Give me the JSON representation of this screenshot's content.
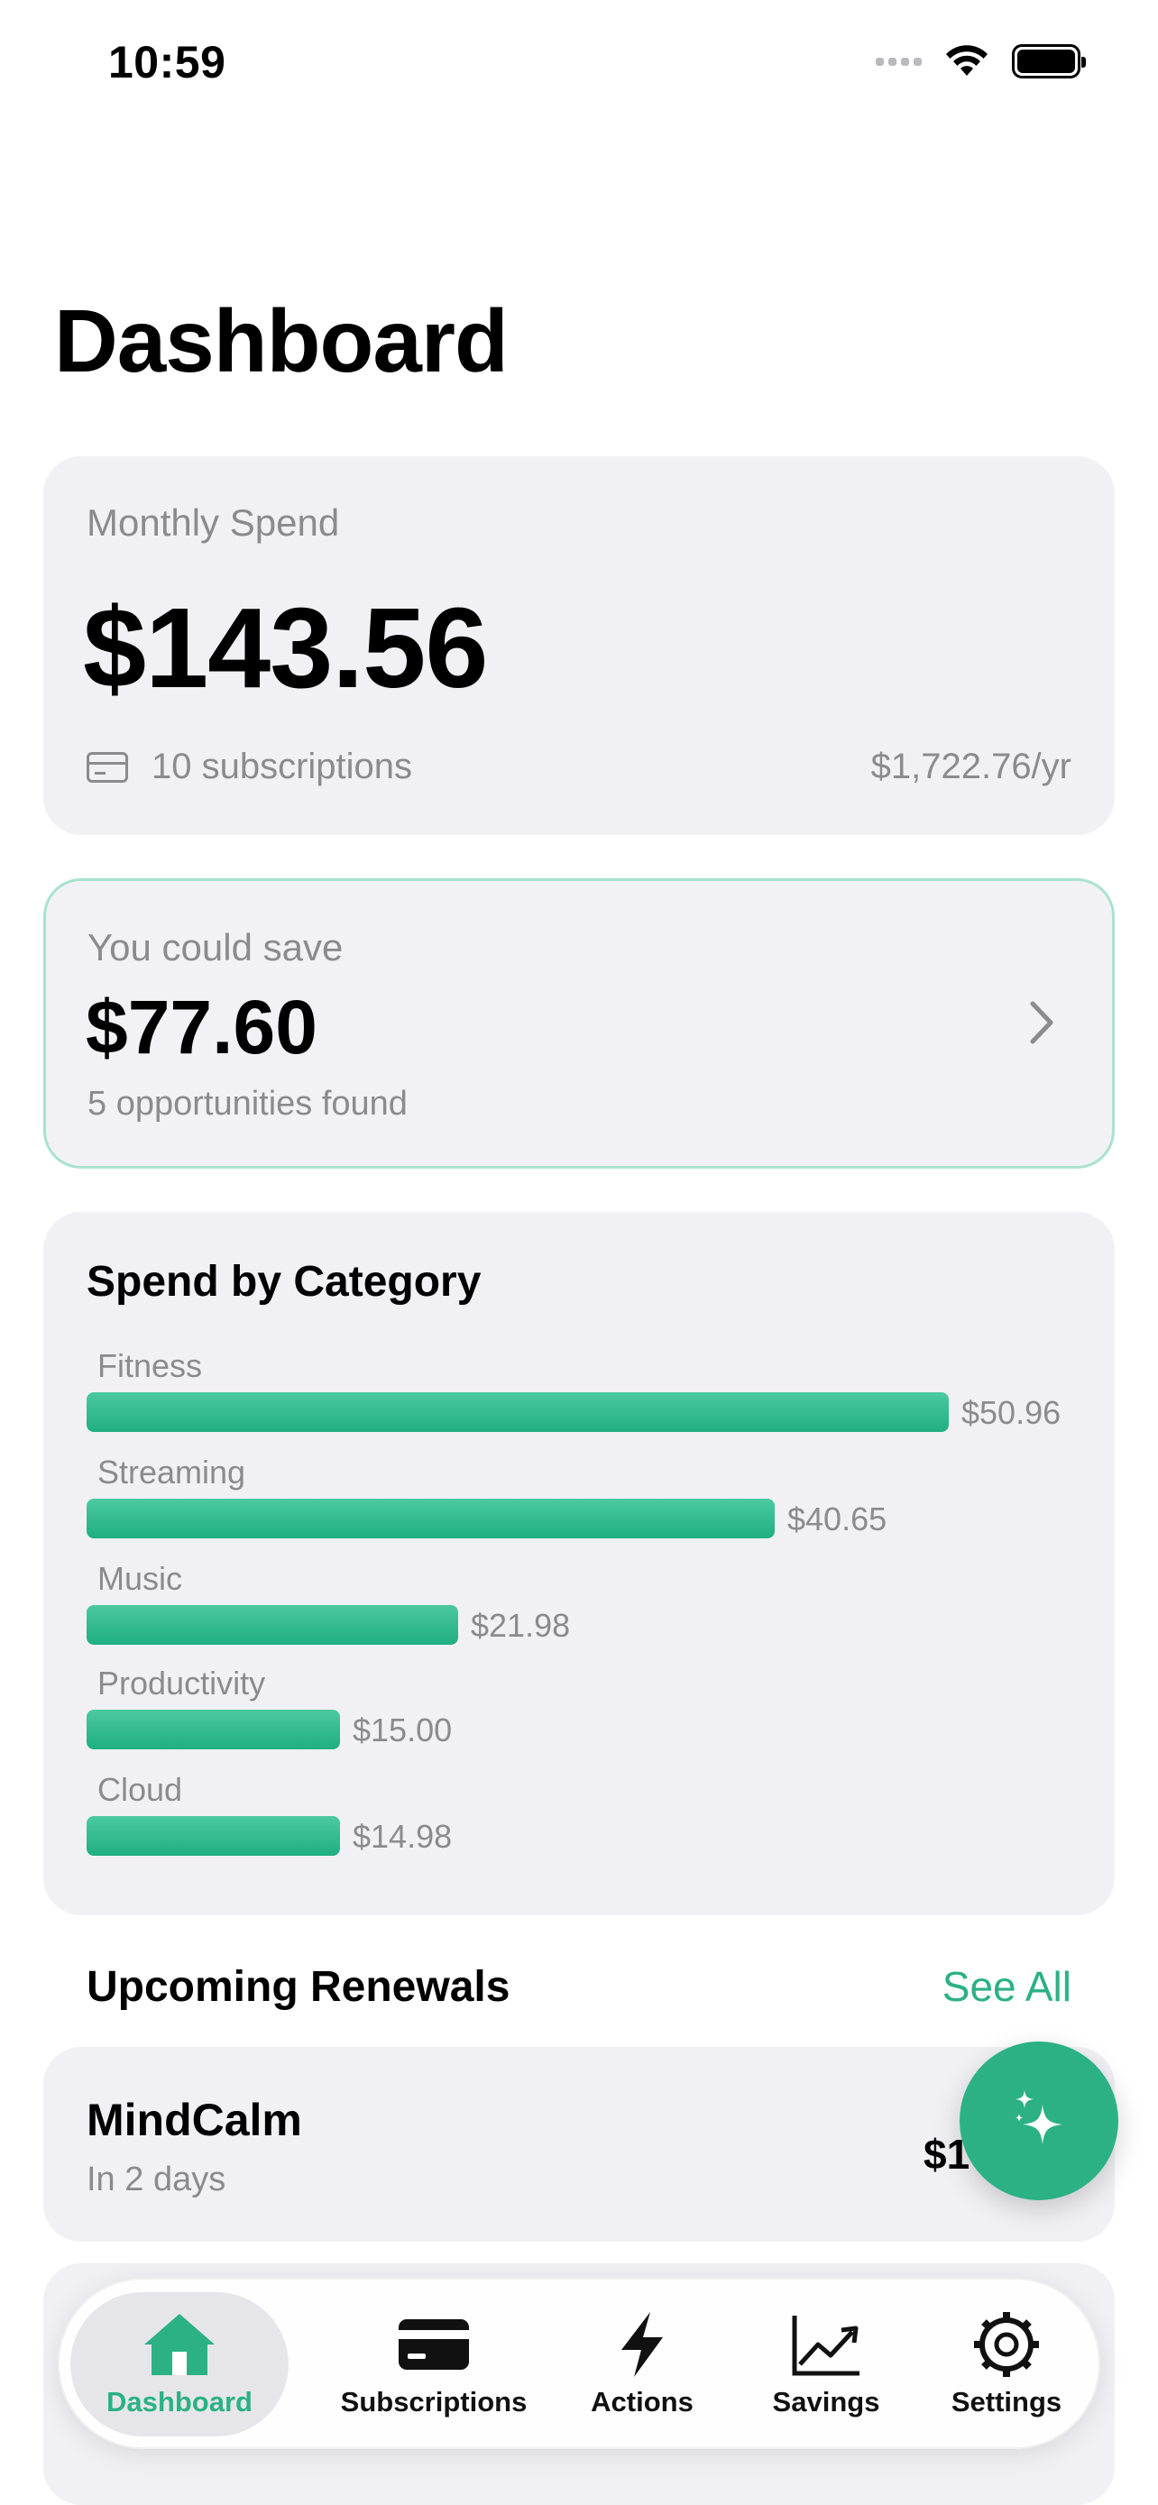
{
  "status_bar": {
    "time": "10:59"
  },
  "page": {
    "title": "Dashboard"
  },
  "monthly_spend": {
    "label": "Monthly Spend",
    "amount": "$143.56",
    "subscriptions": "10 subscriptions",
    "yearly": "$1,722.76/yr"
  },
  "savings": {
    "label": "You could save",
    "amount": "$77.60",
    "opportunities": "5 opportunities found"
  },
  "category": {
    "title": "Spend by Category",
    "items": [
      {
        "label": "Fitness",
        "value_text": "$50.96",
        "value": 50.96
      },
      {
        "label": "Streaming",
        "value_text": "$40.65",
        "value": 40.65
      },
      {
        "label": "Music",
        "value_text": "$21.98",
        "value": 21.98
      },
      {
        "label": "Productivity",
        "value_text": "$15.00",
        "value": 15.0
      },
      {
        "label": "Cloud",
        "value_text": "$14.98",
        "value": 14.98
      }
    ]
  },
  "chart_data": {
    "type": "bar",
    "title": "Spend by Category",
    "categories": [
      "Fitness",
      "Streaming",
      "Music",
      "Productivity",
      "Cloud"
    ],
    "values": [
      50.96,
      40.65,
      21.98,
      15.0,
      14.98
    ],
    "orientation": "horizontal",
    "grid": false
  },
  "upcoming": {
    "title": "Upcoming Renewals",
    "see_all": "See All",
    "items": [
      {
        "name": "MindCalm",
        "when": "In 2 days",
        "price": "$1"
      }
    ]
  },
  "tabbar": {
    "tabs": [
      {
        "label": "Dashboard",
        "icon": "house-icon",
        "active": true
      },
      {
        "label": "Subscriptions",
        "icon": "credit-card-icon",
        "active": false
      },
      {
        "label": "Actions",
        "icon": "bolt-icon",
        "active": false
      },
      {
        "label": "Savings",
        "icon": "trend-chart-icon",
        "active": false
      },
      {
        "label": "Settings",
        "icon": "gear-icon",
        "active": false
      }
    ]
  },
  "colors": {
    "accent": "#2bb184",
    "card": "#f1f1f5",
    "secondary_text": "#8a8a8f"
  }
}
